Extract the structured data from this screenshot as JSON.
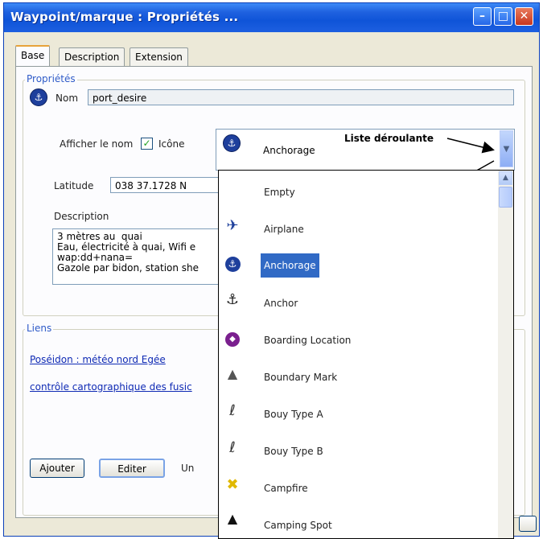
{
  "window": {
    "title": "Waypoint/marque : Propriétés ..."
  },
  "tabs": [
    {
      "label": "Base",
      "active": true
    },
    {
      "label": "Description",
      "active": false
    },
    {
      "label": "Extension",
      "active": false
    }
  ],
  "proprietes": {
    "legend": "Propriétés",
    "nom_label": "Nom",
    "nom_value": "port_desire",
    "afficher_nom_label": "Afficher le nom",
    "afficher_nom_checked": true,
    "icone_label": "Icône",
    "latitude_label": "Latitude",
    "latitude_value": "038 37.1728 N",
    "description_label": "Description",
    "description_text": "3 mètres au  quai\nEau, électricité à quai, Wifi e\nwap:dd+nana=\nGazole par bidon, station she"
  },
  "liens": {
    "legend": "Liens",
    "links": [
      "Poséidon : météo nord Egée",
      "contrôle cartographique des fusic"
    ],
    "ajouter_label": "Ajouter",
    "editer_label": "Editer",
    "trailing_label": "Un"
  },
  "combo": {
    "selected_label": "Anchorage",
    "selected_icon": "anchorage-icon"
  },
  "annotation": {
    "text": "Liste déroulante"
  },
  "dropdown": {
    "items": [
      {
        "label": "Empty",
        "icon": "none"
      },
      {
        "label": "Airplane",
        "icon": "airplane-icon"
      },
      {
        "label": "Anchorage",
        "icon": "anchorage-icon",
        "selected": true
      },
      {
        "label": "Anchor",
        "icon": "anchor-icon"
      },
      {
        "label": "Boarding Location",
        "icon": "boarding-location-icon"
      },
      {
        "label": "Boundary Mark",
        "icon": "boundary-mark-icon"
      },
      {
        "label": "Bouy Type A",
        "icon": "bouy-type-a-icon"
      },
      {
        "label": "Bouy Type B",
        "icon": "bouy-type-b-icon"
      },
      {
        "label": "Campfire",
        "icon": "campfire-icon"
      },
      {
        "label": "Camping Spot",
        "icon": "camping-spot-icon"
      }
    ]
  },
  "colors": {
    "titlebar": "#1f62e0",
    "selection": "#316ac5",
    "legend_text": "#2f5bc8",
    "link": "#0f2ab4"
  }
}
